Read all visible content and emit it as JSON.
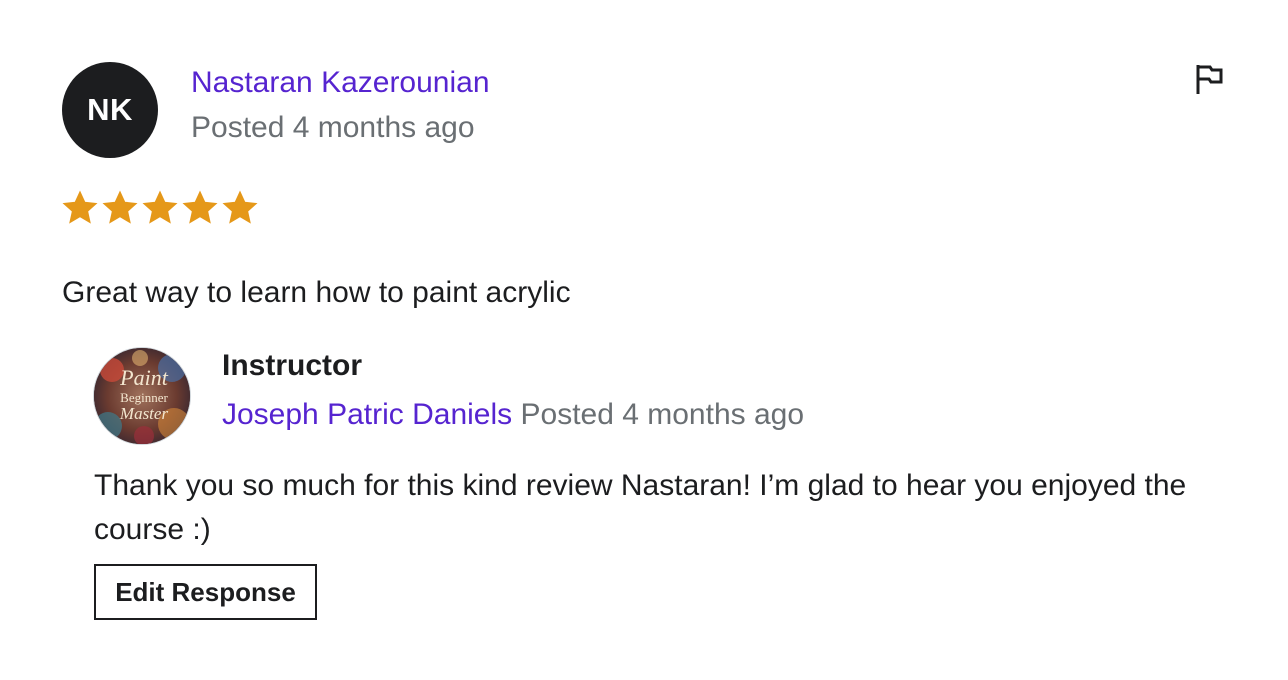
{
  "review": {
    "avatar_initials": "NK",
    "reviewer_name": "Nastaran Kazerounian",
    "posted": "Posted 4 months ago",
    "rating": 5,
    "rating_max": 5,
    "star_color": "#e59819",
    "text": "Great way to learn how to paint acrylic",
    "flag_icon": "flag-icon"
  },
  "response": {
    "label": "Instructor",
    "instructor_name": "Joseph Patric Daniels",
    "posted": "Posted 4 months ago",
    "text": "Thank you so much for this kind review Nastaran! I’m glad to hear you enjoyed the course :)",
    "avatar_text": [
      "Paint",
      "Beginner",
      "Master"
    ],
    "edit_label": "Edit Response"
  },
  "colors": {
    "link": "#5624d0",
    "muted": "#6a6f73",
    "text": "#1c1d1f"
  }
}
